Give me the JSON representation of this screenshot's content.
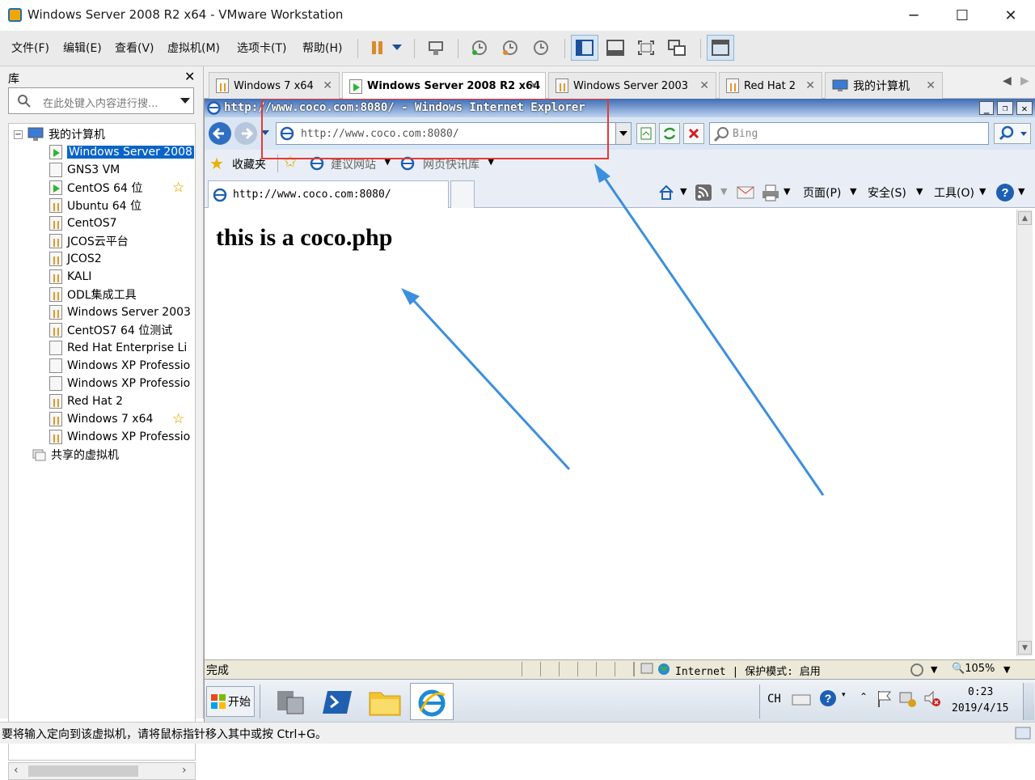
{
  "window": {
    "title": "Windows Server 2008 R2 x64 - VMware Workstation",
    "minimize": "─",
    "maximize": "☐",
    "close": "✕"
  },
  "menu": [
    "文件(F)",
    "编辑(E)",
    "查看(V)",
    "虚拟机(M)",
    "选项卡(T)",
    "帮助(H)"
  ],
  "library": {
    "title": "库",
    "close": "✕",
    "search_placeholder": "在此处键入内容进行搜...",
    "root": "我的计算机",
    "shared": "共享的虚拟机",
    "items": [
      {
        "label": "Windows Server 2008",
        "state": "running",
        "selected": true
      },
      {
        "label": "GNS3 VM",
        "state": "off"
      },
      {
        "label": "CentOS 64 位",
        "state": "running",
        "star": true
      },
      {
        "label": "Ubuntu 64 位",
        "state": "suspended"
      },
      {
        "label": "CentOS7",
        "state": "suspended"
      },
      {
        "label": "JCOS云平台",
        "state": "suspended"
      },
      {
        "label": "JCOS2",
        "state": "suspended"
      },
      {
        "label": "KALI",
        "state": "suspended"
      },
      {
        "label": "ODL集成工具",
        "state": "suspended"
      },
      {
        "label": "Windows Server 2003",
        "state": "suspended"
      },
      {
        "label": "CentOS7 64 位测试",
        "state": "suspended"
      },
      {
        "label": "Red Hat Enterprise Li",
        "state": "off"
      },
      {
        "label": "Windows XP Professio",
        "state": "off"
      },
      {
        "label": "Windows XP Professio",
        "state": "off"
      },
      {
        "label": "Red Hat 2",
        "state": "suspended"
      },
      {
        "label": "Windows 7 x64",
        "state": "suspended",
        "star": true
      },
      {
        "label": "Windows XP Professio",
        "state": "suspended"
      }
    ]
  },
  "tabs": [
    {
      "label": "Windows 7 x64"
    },
    {
      "label": "Windows Server 2008 R2 x64",
      "active": true
    },
    {
      "label": "Windows Server 2003"
    },
    {
      "label": "Red Hat 2"
    },
    {
      "label": "我的计算机"
    }
  ],
  "ie": {
    "title": "http://www.coco.com:8080/ - Windows Internet Explorer",
    "address": "http://www.coco.com:8080/",
    "search_placeholder": "Bing",
    "favorites": "收藏夹",
    "suggested_sites": "建议网站",
    "web_slice": "网页快讯库",
    "tab_title": "http://www.coco.com:8080/",
    "page_menu": "页面(P)",
    "safety_menu": "安全(S)",
    "tools_menu": "工具(O)",
    "page_heading": "this is a coco.php",
    "status_done": "完成",
    "zone": "Internet | 保护模式: 启用",
    "zoom": "105%"
  },
  "taskbar": {
    "start": "开始",
    "lang": "CH",
    "time": "0:23",
    "date": "2019/4/15"
  },
  "status_text": "要将输入定向到该虚拟机，请将鼠标指针移入其中或按 Ctrl+G。",
  "colors": {
    "accent": "#0a64c8",
    "annotation_box": "#e53935",
    "annotation_arrow": "#3c8fde",
    "ie_title": "#3e6cb5"
  }
}
